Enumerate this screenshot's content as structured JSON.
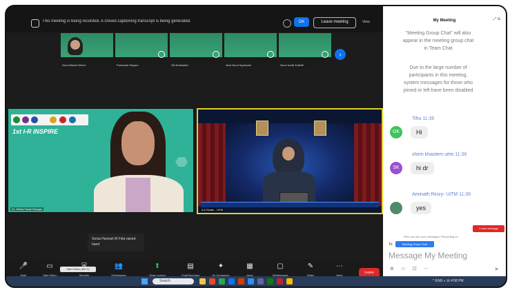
{
  "topbar": {
    "recording_text": "This meeting is being recorded. A closed captioning transcript is being generated.",
    "ok_label": "OK",
    "leave_label": "Leave meeting",
    "view_label": "View"
  },
  "thumbnails": [
    {
      "name": "Nurul Aishah Mohd"
    },
    {
      "name": "Farhanah Hisyam"
    },
    {
      "name": "Siti Nurfazilah"
    },
    {
      "name": "Aina Nurul Syazwani"
    },
    {
      "name": "Nurul Izzati Zulkefli"
    }
  ],
  "thumbs_next": "›",
  "left_tile": {
    "event_title": "1st I-R INSPIRE",
    "name": "Dr. Sheila Farah Rangan"
  },
  "right_tile": {
    "name": "ILA Studio - UiTM"
  },
  "toast": "Sonia Hannah M Fida raised hand",
  "tooltip": "Start Video (Alt+V)",
  "toolbar": {
    "items": [
      {
        "label": "Mute",
        "icon": "🎤"
      },
      {
        "label": "Start Video",
        "icon": "▭"
      },
      {
        "label": "Security",
        "icon": "⛨"
      },
      {
        "label": "Participants",
        "icon": "👥"
      },
      {
        "label": "Share screen",
        "icon": "⬆"
      },
      {
        "label": "Chat/Summary",
        "icon": "▤"
      },
      {
        "label": "AI Companion",
        "icon": "✦"
      },
      {
        "label": "Apps",
        "icon": "▦"
      },
      {
        "label": "Whiteboards",
        "icon": "▢"
      },
      {
        "label": "Notes",
        "icon": "✎"
      },
      {
        "label": "More",
        "icon": "⋯"
      }
    ],
    "end_label": "Leave"
  },
  "taskbar": {
    "search_placeholder": "Search",
    "time": "4:58 PM",
    "tray": "^  ENG  ◐  ⊟"
  },
  "chat": {
    "title": "My Meeting",
    "controls": "⤢ ⊟",
    "system_message_1": "\"Meeting Group Chat\" will also appear in the meeting group chat in Team Chat",
    "system_message_2": "Due to the large number of participants in this meeting, system messages for those who joined or left have been disabled",
    "messages": [
      {
        "initials": "OK",
        "avatar_color": "#3ec45a",
        "sender": "Tihu",
        "time": "11:36",
        "text": "Hi"
      },
      {
        "initials": "SK",
        "avatar_color": "#9b4fd1",
        "sender": "shirin khastem uitm",
        "time": "11:38",
        "text": "hi dr"
      },
      {
        "initials": "",
        "avatar_color": "#4f8a6c",
        "sender": "Aminath Rinzy- UiTM",
        "time": "11:39",
        "text": "yes"
      }
    ],
    "new_message_badge": "1 new message",
    "privacy_note": "Who can see your messages? Recording on",
    "to_label": "To:",
    "to_target": "Meeting Group Chat",
    "input_placeholder": "Message My Meeting",
    "input_icons": "⊕ ☺ ⊡ ⋯",
    "send_icon": "➤"
  }
}
